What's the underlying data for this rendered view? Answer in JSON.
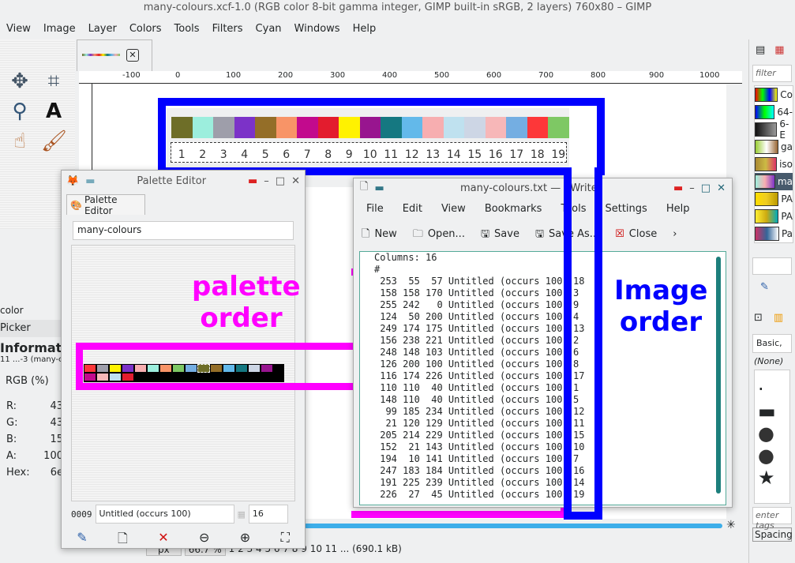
{
  "window_title": "many-colours.xcf-1.0 (RGB color 8-bit gamma integer, GIMP built-in sRGB, 2 layers) 760x80 – GIMP",
  "menu": [
    "View",
    "Image",
    "Layer",
    "Colors",
    "Tools",
    "Filters",
    "Cyan",
    "Windows",
    "Help"
  ],
  "ruler_labels": [
    "-100",
    "0",
    "100",
    "200",
    "300",
    "400",
    "500",
    "600",
    "700",
    "800",
    "900",
    "1000"
  ],
  "image": {
    "swatches": [
      "#6e6e28",
      "#9ceedd",
      "#9e9eaa",
      "#7c32c8",
      "#946e28",
      "#f89467",
      "#c20a8d",
      "#e31c2e",
      "#fff200",
      "#98158f",
      "#157881",
      "#63b9ea",
      "#f7aeb0",
      "#bfe1ef",
      "#cdd6e5",
      "#f7b7b8",
      "#74aee2",
      "#fd3739",
      "#7ec864"
    ],
    "numbers": [
      "1",
      "2",
      "3",
      "4",
      "5",
      "6",
      "7",
      "8",
      "9",
      "10",
      "11",
      "12",
      "13",
      "14",
      "15",
      "16",
      "17",
      "18",
      "19"
    ]
  },
  "annotations": {
    "palette_order": [
      "palette",
      "order"
    ],
    "image_order": [
      "Image",
      "order"
    ],
    "magenta": "#ff00ff",
    "blue": "#0000ff"
  },
  "left_panel": {
    "color_tab": "color",
    "picker_tab": "Picker",
    "info_title": "Informati",
    "info_sub": "11 ...-3 (many-c",
    "mode": "RGB (%)",
    "fields": [
      {
        "k": "R:",
        "v": "43"
      },
      {
        "k": "G:",
        "v": "43"
      },
      {
        "k": "B:",
        "v": "15"
      },
      {
        "k": "A:",
        "v": "100"
      },
      {
        "k": "Hex:",
        "v": "6e"
      }
    ]
  },
  "palette_editor": {
    "title": "Palette Editor",
    "tab": "Palette Editor",
    "name": "many-colours",
    "cells": [
      "#fd3739",
      "#9e9eaa",
      "#fff200",
      "#7c32c8",
      "#f7aeb0",
      "#9ceedd",
      "#f89467",
      "#7ec864",
      "#74aee2",
      "#6e6e28",
      "#946e28",
      "#63b9ea",
      "#157881",
      "#cdd6e5",
      "#98158f",
      "#c20a8d",
      "#f7b7b8",
      "#bfe1ef",
      "#e31c2e"
    ],
    "index": "0009",
    "entry_name": "Untitled (occurs 100)",
    "columns": "16"
  },
  "kwrite": {
    "title": "many-colours.txt — KWrite",
    "menu": [
      "File",
      "Edit",
      "View",
      "Bookmarks",
      "Tools",
      "Settings",
      "Help"
    ],
    "toolbar": {
      "new": "New",
      "open": "Open...",
      "save": "Save",
      "save_as": "Save As...",
      "close": "Close"
    },
    "header": [
      "Columns: 16",
      "#"
    ],
    "lines": [
      " 253  55  57 Untitled (occurs 100",
      " 158 158 170 Untitled (occurs 100",
      " 255 242   0 Untitled (occurs 100",
      " 124  50 200 Untitled (occurs 100",
      " 249 174 175 Untitled (occurs 100",
      " 156 238 221 Untitled (occurs 100",
      " 248 148 103 Untitled (occurs 100",
      " 126 200 100 Untitled (occurs 100",
      " 116 174 226 Untitled (occurs 100",
      " 110 110  40 Untitled (occurs 100",
      " 148 110  40 Untitled (occurs 100",
      "  99 185 234 Untitled (occurs 100",
      "  21 120 129 Untitled (occurs 100",
      " 205 214 229 Untitled (occurs 100",
      " 152  21 143 Untitled (occurs 100",
      " 194  10 141 Untitled (occurs 100",
      " 247 183 184 Untitled (occurs 100",
      " 191 225 239 Untitled (occurs 100",
      " 226  27  45 Untitled (occurs 100"
    ],
    "image_order": [
      "18",
      "3",
      "9",
      "4",
      "13",
      "2",
      "6",
      "8",
      "17",
      "1",
      "5",
      "12",
      "11",
      "15",
      "10",
      "7",
      "16",
      "14",
      "19"
    ]
  },
  "right_dock": {
    "filter_placeholder": "filter",
    "palettes": [
      "Co",
      "64-",
      "6-E",
      "ga",
      "iso",
      "ma",
      "PA",
      "PA",
      "Pa"
    ],
    "brush_preset": "Basic,",
    "brush_none": "(None)",
    "tags_placeholder": "enter tags",
    "spacing": "Spacing"
  },
  "status": {
    "unit": "px",
    "zoom": "66.7 %",
    "text": "1 2 3 4 5 6 7 8 9 10 11 ... (690.1 kB)"
  }
}
